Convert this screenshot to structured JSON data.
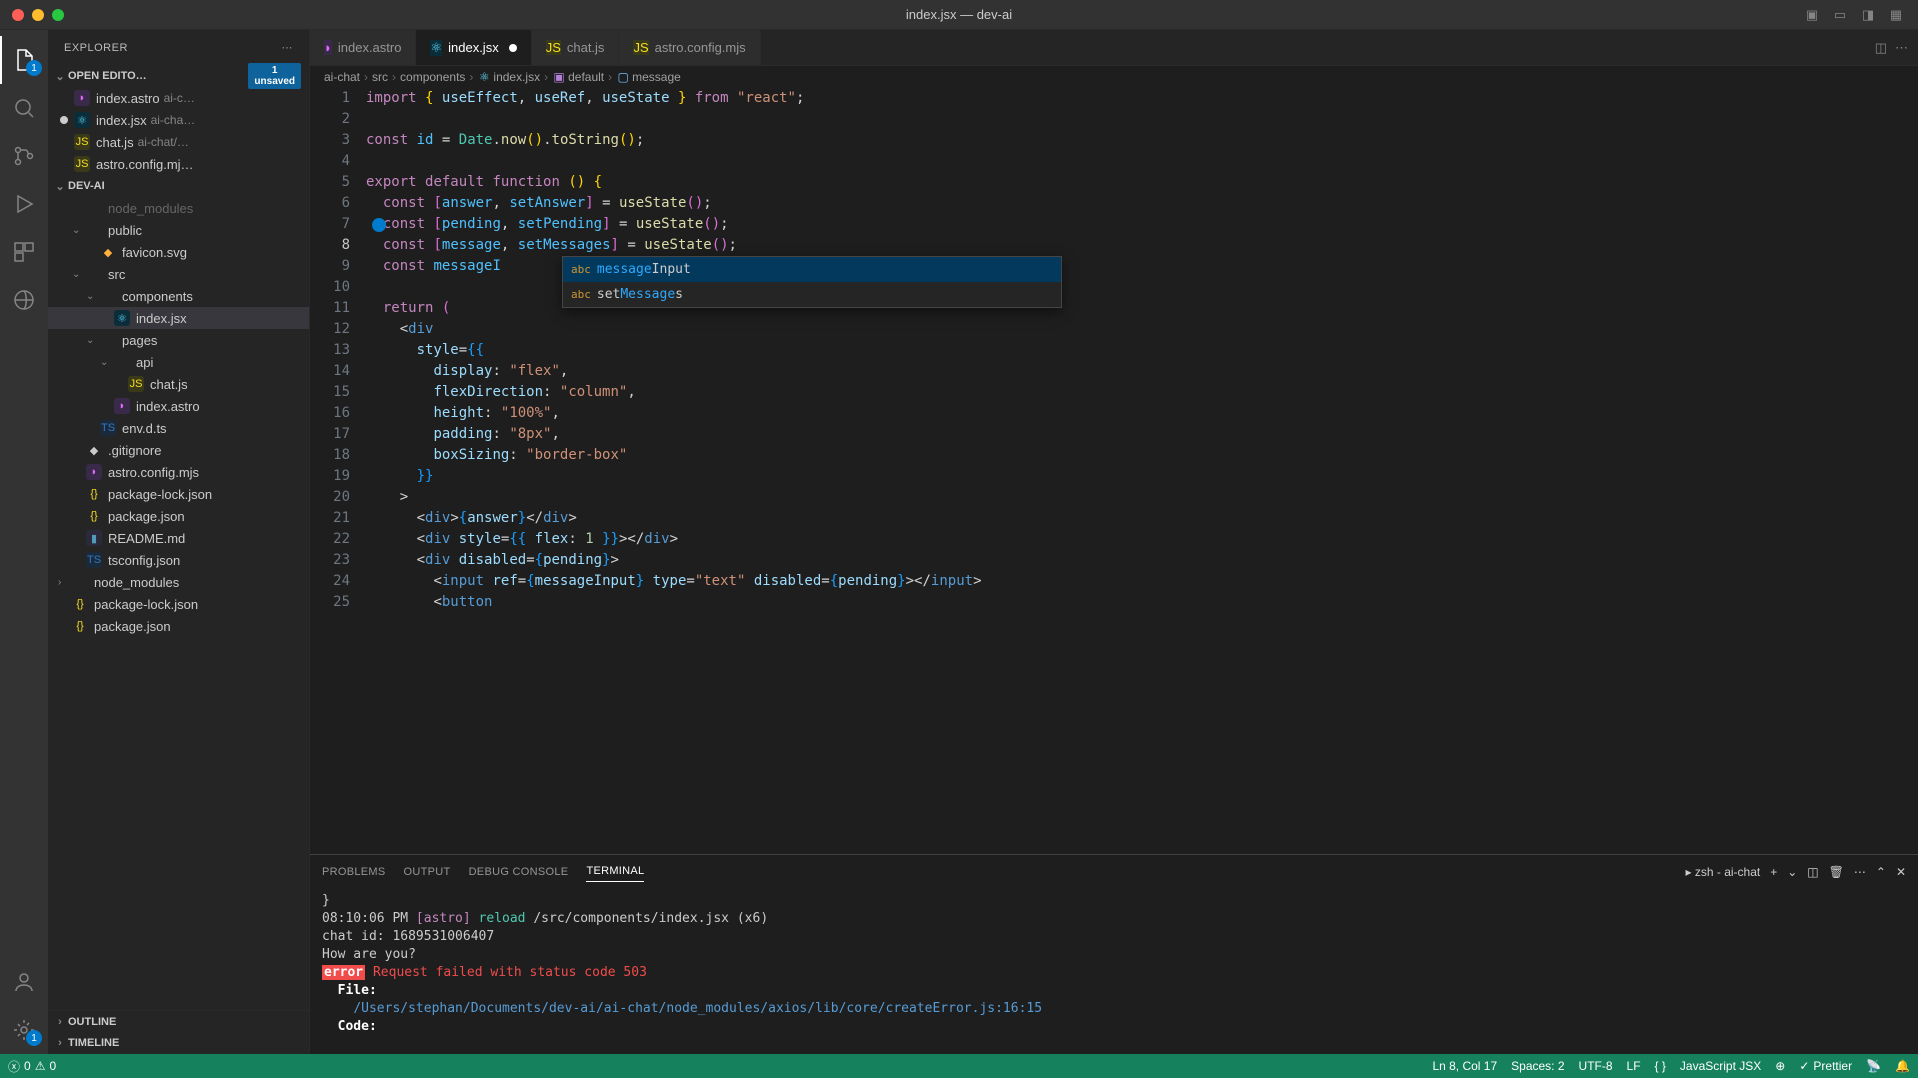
{
  "titlebar": {
    "title": "index.jsx — dev-ai"
  },
  "activity": {
    "explorer_badge": "1",
    "settings_badge": "1"
  },
  "sidebar": {
    "title": "EXPLORER",
    "open_editors": {
      "label": "OPEN EDITO…",
      "unsaved_count": "1",
      "unsaved_label": "unsaved",
      "items": [
        {
          "name": "index.astro",
          "hint": "ai-c…",
          "icon": "astro"
        },
        {
          "name": "index.jsx",
          "hint": "ai-cha…",
          "icon": "react",
          "modified": true
        },
        {
          "name": "chat.js",
          "hint": "ai-chat/…",
          "icon": "js"
        },
        {
          "name": "astro.config.mj…",
          "hint": "",
          "icon": "js"
        }
      ]
    },
    "project": {
      "label": "DEV-AI",
      "tree": [
        {
          "depth": 1,
          "chev": "",
          "icon": "",
          "name": "node_modules",
          "dim": true
        },
        {
          "depth": 1,
          "chev": "v",
          "icon": "folder",
          "name": "public"
        },
        {
          "depth": 2,
          "chev": "",
          "icon": "svg",
          "name": "favicon.svg"
        },
        {
          "depth": 1,
          "chev": "v",
          "icon": "folder",
          "name": "src"
        },
        {
          "depth": 2,
          "chev": "v",
          "icon": "folder",
          "name": "components"
        },
        {
          "depth": 3,
          "chev": "",
          "icon": "react",
          "name": "index.jsx",
          "selected": true
        },
        {
          "depth": 2,
          "chev": "v",
          "icon": "folder",
          "name": "pages"
        },
        {
          "depth": 3,
          "chev": "v",
          "icon": "folder",
          "name": "api"
        },
        {
          "depth": 4,
          "chev": "",
          "icon": "js",
          "name": "chat.js"
        },
        {
          "depth": 3,
          "chev": "",
          "icon": "astro",
          "name": "index.astro"
        },
        {
          "depth": 2,
          "chev": "",
          "icon": "ts",
          "name": "env.d.ts"
        },
        {
          "depth": 1,
          "chev": "",
          "icon": "git",
          "name": ".gitignore"
        },
        {
          "depth": 1,
          "chev": "",
          "icon": "astro",
          "name": "astro.config.mjs"
        },
        {
          "depth": 1,
          "chev": "",
          "icon": "json",
          "name": "package-lock.json"
        },
        {
          "depth": 1,
          "chev": "",
          "icon": "json",
          "name": "package.json"
        },
        {
          "depth": 1,
          "chev": "",
          "icon": "md",
          "name": "README.md"
        },
        {
          "depth": 1,
          "chev": "",
          "icon": "ts",
          "name": "tsconfig.json"
        },
        {
          "depth": 0,
          "chev": ">",
          "icon": "folder",
          "name": "node_modules"
        },
        {
          "depth": 0,
          "chev": "",
          "icon": "json",
          "name": "package-lock.json"
        },
        {
          "depth": 0,
          "chev": "",
          "icon": "json",
          "name": "package.json"
        }
      ]
    },
    "outline": "OUTLINE",
    "timeline": "TIMELINE"
  },
  "tabs": [
    {
      "name": "index.astro",
      "icon": "astro"
    },
    {
      "name": "index.jsx",
      "icon": "react",
      "active": true,
      "modified": true
    },
    {
      "name": "chat.js",
      "icon": "js"
    },
    {
      "name": "astro.config.mjs",
      "icon": "js"
    }
  ],
  "breadcrumb": [
    "ai-chat",
    "src",
    "components",
    "index.jsx",
    "default",
    "message"
  ],
  "code": {
    "lines": 25,
    "active_line": 8
  },
  "autocomplete": {
    "items": [
      {
        "pre": "message",
        "post": "Input",
        "selected": true
      },
      {
        "pre": "set",
        "mid": "Message",
        "post": "s"
      }
    ]
  },
  "panel": {
    "tabs": [
      "PROBLEMS",
      "OUTPUT",
      "DEBUG CONSOLE",
      "TERMINAL"
    ],
    "active_tab": "TERMINAL",
    "shell": "zsh - ai-chat",
    "term": {
      "l1": "}",
      "l2_time": "08:10:06 PM",
      "l2_astro": "[astro]",
      "l2_reload": "reload",
      "l2_path": "/src/components/index.jsx (x6)",
      "l3": "chat id: 1689531006407",
      "l4": "How are you?",
      "l5_err": "error",
      "l5_msg": "   Request failed with status code 503",
      "l6_label": "File:",
      "l6_path": "/Users/stephan/Documents/dev-ai/ai-chat/node_modules/axios/lib/core/createError.js:16:15",
      "l7": "Code:"
    }
  },
  "statusbar": {
    "errors": "0",
    "warnings": "0",
    "cursor": "Ln 8, Col 17",
    "spaces": "Spaces: 2",
    "encoding": "UTF-8",
    "eol": "LF",
    "lang": "JavaScript JSX",
    "prettier": "Prettier"
  }
}
